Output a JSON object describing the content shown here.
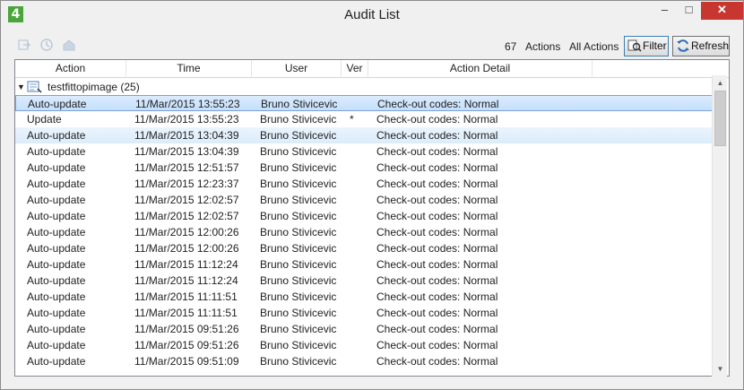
{
  "window": {
    "title": "Audit List",
    "app_icon_label": "4",
    "minimize_glyph": "–",
    "maximize_glyph": "□",
    "close_glyph": "✕"
  },
  "toolbar": {
    "icons": [
      "export-icon",
      "history-icon",
      "home-icon"
    ],
    "count": "67",
    "count_label": "Actions",
    "scope_label": "All Actions",
    "filter_label": "Filter",
    "refresh_label": "Refresh"
  },
  "table": {
    "columns": [
      "Action",
      "Time",
      "User",
      "Ver",
      "Action Detail"
    ],
    "group": {
      "label": "testfittopimage (25)"
    },
    "rows": [
      {
        "action": "Auto-update",
        "time": "11/Mar/2015 13:55:23",
        "user": "Bruno Stivicevic",
        "ver": "",
        "detail": "Check-out codes: Normal",
        "state": "selected"
      },
      {
        "action": "Update",
        "time": "11/Mar/2015 13:55:23",
        "user": "Bruno Stivicevic",
        "ver": "*",
        "detail": "Check-out codes: Normal",
        "state": ""
      },
      {
        "action": "Auto-update",
        "time": "11/Mar/2015 13:04:39",
        "user": "Bruno Stivicevic",
        "ver": "",
        "detail": "Check-out codes: Normal",
        "state": "hover"
      },
      {
        "action": "Auto-update",
        "time": "11/Mar/2015 13:04:39",
        "user": "Bruno Stivicevic",
        "ver": "",
        "detail": "Check-out codes: Normal",
        "state": ""
      },
      {
        "action": "Auto-update",
        "time": "11/Mar/2015 12:51:57",
        "user": "Bruno Stivicevic",
        "ver": "",
        "detail": "Check-out codes: Normal",
        "state": ""
      },
      {
        "action": "Auto-update",
        "time": "11/Mar/2015 12:23:37",
        "user": "Bruno Stivicevic",
        "ver": "",
        "detail": "Check-out codes: Normal",
        "state": ""
      },
      {
        "action": "Auto-update",
        "time": "11/Mar/2015 12:02:57",
        "user": "Bruno Stivicevic",
        "ver": "",
        "detail": "Check-out codes: Normal",
        "state": ""
      },
      {
        "action": "Auto-update",
        "time": "11/Mar/2015 12:02:57",
        "user": "Bruno Stivicevic",
        "ver": "",
        "detail": "Check-out codes: Normal",
        "state": ""
      },
      {
        "action": "Auto-update",
        "time": "11/Mar/2015 12:00:26",
        "user": "Bruno Stivicevic",
        "ver": "",
        "detail": "Check-out codes: Normal",
        "state": ""
      },
      {
        "action": "Auto-update",
        "time": "11/Mar/2015 12:00:26",
        "user": "Bruno Stivicevic",
        "ver": "",
        "detail": "Check-out codes: Normal",
        "state": ""
      },
      {
        "action": "Auto-update",
        "time": "11/Mar/2015 11:12:24",
        "user": "Bruno Stivicevic",
        "ver": "",
        "detail": "Check-out codes: Normal",
        "state": ""
      },
      {
        "action": "Auto-update",
        "time": "11/Mar/2015 11:12:24",
        "user": "Bruno Stivicevic",
        "ver": "",
        "detail": "Check-out codes: Normal",
        "state": ""
      },
      {
        "action": "Auto-update",
        "time": "11/Mar/2015 11:11:51",
        "user": "Bruno Stivicevic",
        "ver": "",
        "detail": "Check-out codes: Normal",
        "state": ""
      },
      {
        "action": "Auto-update",
        "time": "11/Mar/2015 11:11:51",
        "user": "Bruno Stivicevic",
        "ver": "",
        "detail": "Check-out codes: Normal",
        "state": ""
      },
      {
        "action": "Auto-update",
        "time": "11/Mar/2015 09:51:26",
        "user": "Bruno Stivicevic",
        "ver": "",
        "detail": "Check-out codes: Normal",
        "state": ""
      },
      {
        "action": "Auto-update",
        "time": "11/Mar/2015 09:51:26",
        "user": "Bruno Stivicevic",
        "ver": "",
        "detail": "Check-out codes: Normal",
        "state": ""
      },
      {
        "action": "Auto-update",
        "time": "11/Mar/2015 09:51:09",
        "user": "Bruno Stivicevic",
        "ver": "",
        "detail": "Check-out codes: Normal",
        "state": ""
      }
    ]
  },
  "scrollbar": {
    "up_glyph": "▲",
    "down_glyph": "▼"
  }
}
